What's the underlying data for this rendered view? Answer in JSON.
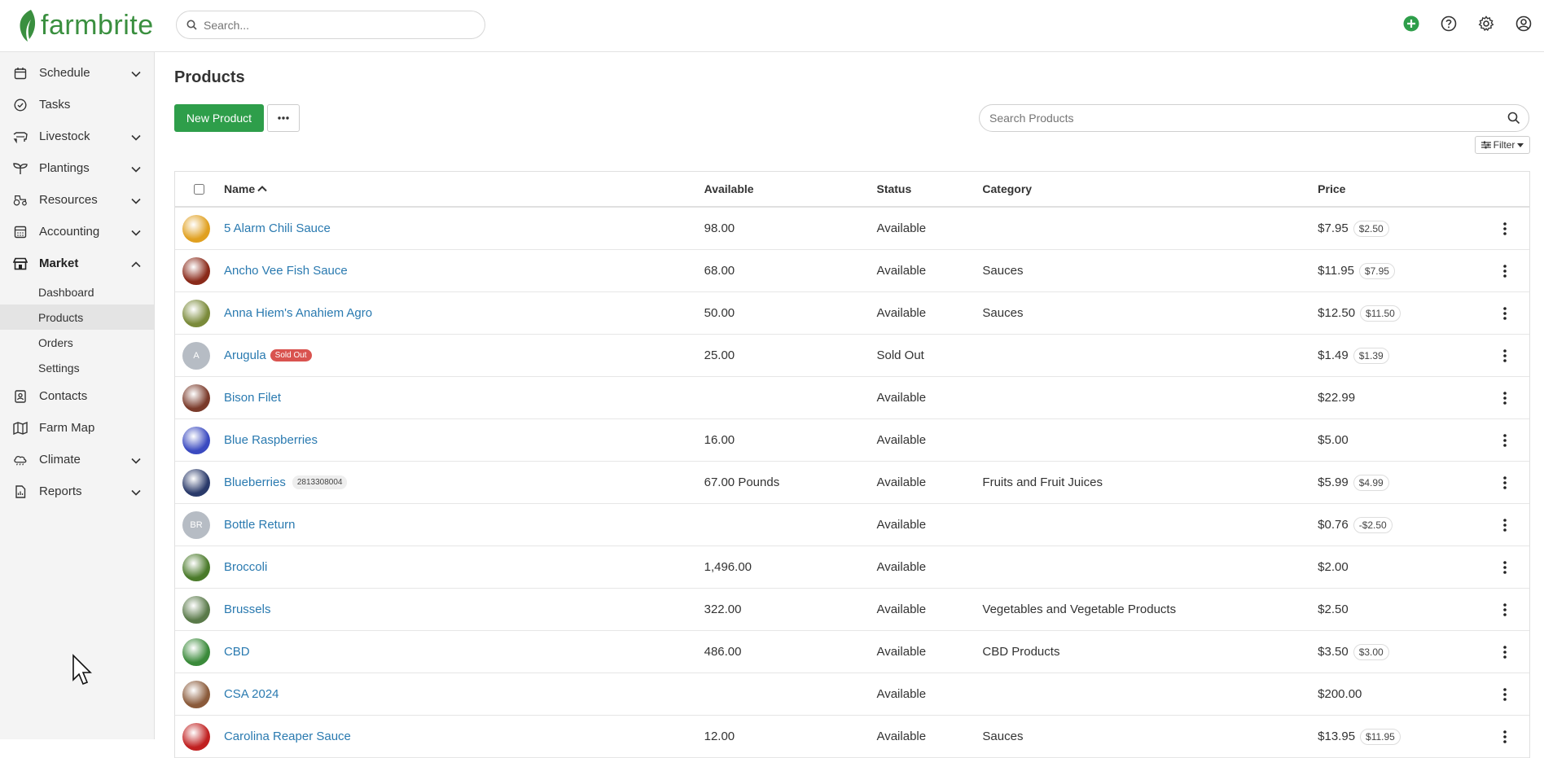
{
  "app": {
    "logo_text": "farmbrite"
  },
  "header": {
    "search_placeholder": "Search..."
  },
  "sidebar": {
    "items": [
      {
        "label": "Schedule",
        "icon": "calendar-icon",
        "chevron": true
      },
      {
        "label": "Tasks",
        "icon": "check-circle-icon",
        "chevron": false
      },
      {
        "label": "Livestock",
        "icon": "livestock-icon",
        "chevron": true
      },
      {
        "label": "Plantings",
        "icon": "sprout-icon",
        "chevron": true
      },
      {
        "label": "Resources",
        "icon": "tractor-icon",
        "chevron": true
      },
      {
        "label": "Accounting",
        "icon": "calculator-icon",
        "chevron": true
      },
      {
        "label": "Market",
        "icon": "market-icon",
        "chevron": true,
        "expanded": true
      },
      {
        "label": "Contacts",
        "icon": "contacts-icon",
        "chevron": false
      },
      {
        "label": "Farm Map",
        "icon": "map-icon",
        "chevron": false
      },
      {
        "label": "Climate",
        "icon": "cloud-icon",
        "chevron": true
      },
      {
        "label": "Reports",
        "icon": "report-icon",
        "chevron": true
      }
    ],
    "market_sub": [
      "Dashboard",
      "Products",
      "Orders",
      "Settings"
    ],
    "selected_sub": "Products"
  },
  "main": {
    "title": "Products",
    "new_button": "New Product",
    "search_placeholder": "Search Products",
    "filter_label": "Filter"
  },
  "table": {
    "columns": {
      "name": "Name",
      "available": "Available",
      "status": "Status",
      "category": "Category",
      "price": "Price"
    },
    "rows": [
      {
        "name": "5 Alarm Chili Sauce",
        "available": "98.00",
        "status": "Available",
        "category": "",
        "price": "$7.95",
        "alt_price": "$2.50",
        "thumb": "#e0a020"
      },
      {
        "name": "Ancho Vee Fish Sauce",
        "available": "68.00",
        "status": "Available",
        "category": "Sauces",
        "price": "$11.95",
        "alt_price": "$7.95",
        "thumb": "#8a2a1a"
      },
      {
        "name": "Anna Hiem's Anahiem Agro",
        "available": "50.00",
        "status": "Available",
        "category": "Sauces",
        "price": "$12.50",
        "alt_price": "$11.50",
        "thumb": "#7a8a3a"
      },
      {
        "name": "Arugula",
        "badge": "Sold Out",
        "available": "25.00",
        "status": "Sold Out",
        "category": "",
        "price": "$1.49",
        "alt_price": "$1.39",
        "initials": "A"
      },
      {
        "name": "Bison Filet",
        "available": "",
        "status": "Available",
        "category": "",
        "price": "$22.99",
        "alt_price": "",
        "thumb": "#7a3a2a"
      },
      {
        "name": "Blue Raspberries",
        "available": "16.00",
        "status": "Available",
        "category": "",
        "price": "$5.00",
        "alt_price": "",
        "thumb": "#3a4ac0"
      },
      {
        "name": "Blueberries",
        "sku": "2813308004",
        "available": "67.00 Pounds",
        "status": "Available",
        "category": "Fruits and Fruit Juices",
        "price": "$5.99",
        "alt_price": "$4.99",
        "thumb": "#2a3a6a"
      },
      {
        "name": "Bottle Return",
        "available": "",
        "status": "Available",
        "category": "",
        "price": "$0.76",
        "alt_price": "-$2.50",
        "initials": "BR"
      },
      {
        "name": "Broccoli",
        "available": "1,496.00",
        "status": "Available",
        "category": "",
        "price": "$2.00",
        "alt_price": "",
        "thumb": "#4a7a2a"
      },
      {
        "name": "Brussels",
        "available": "322.00",
        "status": "Available",
        "category": "Vegetables and Vegetable Products",
        "price": "$2.50",
        "alt_price": "",
        "thumb": "#5a7a4a"
      },
      {
        "name": "CBD",
        "available": "486.00",
        "status": "Available",
        "category": "CBD Products",
        "price": "$3.50",
        "alt_price": "$3.00",
        "thumb": "#3a8a3a"
      },
      {
        "name": "CSA 2024",
        "available": "",
        "status": "Available",
        "category": "",
        "price": "$200.00",
        "alt_price": "",
        "thumb": "#8a5a3a"
      },
      {
        "name": "Carolina Reaper Sauce",
        "available": "12.00",
        "status": "Available",
        "category": "Sauces",
        "price": "$13.95",
        "alt_price": "$11.95",
        "thumb": "#c02020"
      }
    ]
  }
}
